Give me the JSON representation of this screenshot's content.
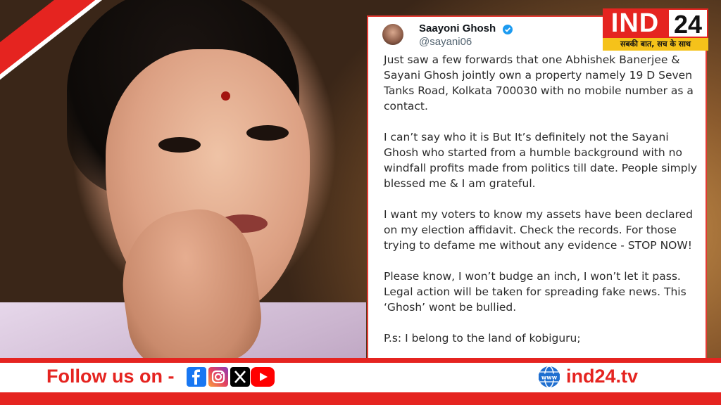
{
  "tweet": {
    "author_name": "Saayoni Ghosh",
    "author_handle": "@sayani06",
    "paragraphs": [
      "Just saw a few forwards that one Abhishek Banerjee & Sayani Ghosh jointly own a property namely 19 D Seven Tanks Road, Kolkata 700030 with no mobile number as a contact.",
      "I can’t say who it is But It’s definitely not the Sayani Ghosh who started from a humble background with no windfall profits made from politics till date. People simply blessed me & I am grateful.",
      "I want my voters to know my assets have been declared on my election affidavit. Check the records. For those trying to defame me without any evidence - STOP NOW!",
      "Please know, I won’t budge an inch, I won’t let it pass. Legal action will be taken for spreading fake news. This ‘Ghosh’ wont be bullied.",
      "P.s: I belong to the land of kobiguru;"
    ]
  },
  "logo": {
    "brand_red": "IND",
    "brand_white": "24",
    "tagline": "सबकी बात, सच के साथ"
  },
  "footer": {
    "follow_label": "Follow us on -",
    "social_icons": [
      "facebook-icon",
      "instagram-icon",
      "x-icon",
      "youtube-icon"
    ],
    "site_url": "ind24.tv"
  },
  "colors": {
    "accent_red": "#e52420",
    "logo_yellow": "#f5c21a",
    "verified_blue": "#1d9bf0"
  }
}
